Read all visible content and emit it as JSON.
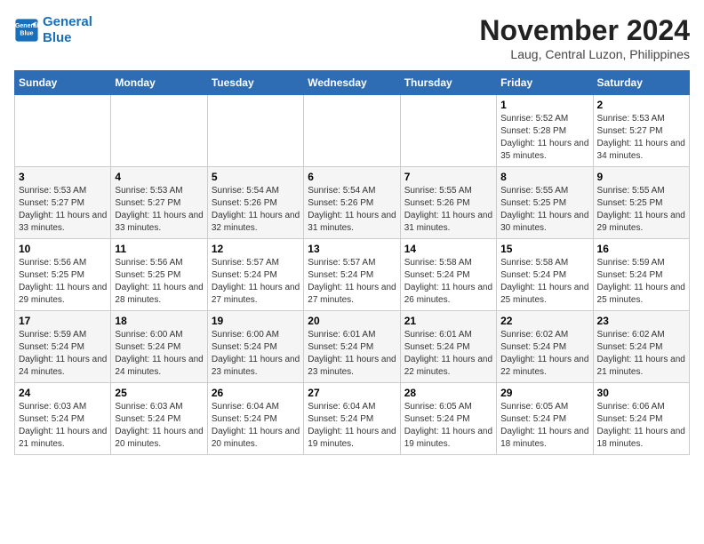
{
  "header": {
    "logo_line1": "General",
    "logo_line2": "Blue",
    "month_title": "November 2024",
    "location": "Laug, Central Luzon, Philippines"
  },
  "weekdays": [
    "Sunday",
    "Monday",
    "Tuesday",
    "Wednesday",
    "Thursday",
    "Friday",
    "Saturday"
  ],
  "weeks": [
    [
      {
        "day": "",
        "info": ""
      },
      {
        "day": "",
        "info": ""
      },
      {
        "day": "",
        "info": ""
      },
      {
        "day": "",
        "info": ""
      },
      {
        "day": "",
        "info": ""
      },
      {
        "day": "1",
        "info": "Sunrise: 5:52 AM\nSunset: 5:28 PM\nDaylight: 11 hours and 35 minutes."
      },
      {
        "day": "2",
        "info": "Sunrise: 5:53 AM\nSunset: 5:27 PM\nDaylight: 11 hours and 34 minutes."
      }
    ],
    [
      {
        "day": "3",
        "info": "Sunrise: 5:53 AM\nSunset: 5:27 PM\nDaylight: 11 hours and 33 minutes."
      },
      {
        "day": "4",
        "info": "Sunrise: 5:53 AM\nSunset: 5:27 PM\nDaylight: 11 hours and 33 minutes."
      },
      {
        "day": "5",
        "info": "Sunrise: 5:54 AM\nSunset: 5:26 PM\nDaylight: 11 hours and 32 minutes."
      },
      {
        "day": "6",
        "info": "Sunrise: 5:54 AM\nSunset: 5:26 PM\nDaylight: 11 hours and 31 minutes."
      },
      {
        "day": "7",
        "info": "Sunrise: 5:55 AM\nSunset: 5:26 PM\nDaylight: 11 hours and 31 minutes."
      },
      {
        "day": "8",
        "info": "Sunrise: 5:55 AM\nSunset: 5:25 PM\nDaylight: 11 hours and 30 minutes."
      },
      {
        "day": "9",
        "info": "Sunrise: 5:55 AM\nSunset: 5:25 PM\nDaylight: 11 hours and 29 minutes."
      }
    ],
    [
      {
        "day": "10",
        "info": "Sunrise: 5:56 AM\nSunset: 5:25 PM\nDaylight: 11 hours and 29 minutes."
      },
      {
        "day": "11",
        "info": "Sunrise: 5:56 AM\nSunset: 5:25 PM\nDaylight: 11 hours and 28 minutes."
      },
      {
        "day": "12",
        "info": "Sunrise: 5:57 AM\nSunset: 5:24 PM\nDaylight: 11 hours and 27 minutes."
      },
      {
        "day": "13",
        "info": "Sunrise: 5:57 AM\nSunset: 5:24 PM\nDaylight: 11 hours and 27 minutes."
      },
      {
        "day": "14",
        "info": "Sunrise: 5:58 AM\nSunset: 5:24 PM\nDaylight: 11 hours and 26 minutes."
      },
      {
        "day": "15",
        "info": "Sunrise: 5:58 AM\nSunset: 5:24 PM\nDaylight: 11 hours and 25 minutes."
      },
      {
        "day": "16",
        "info": "Sunrise: 5:59 AM\nSunset: 5:24 PM\nDaylight: 11 hours and 25 minutes."
      }
    ],
    [
      {
        "day": "17",
        "info": "Sunrise: 5:59 AM\nSunset: 5:24 PM\nDaylight: 11 hours and 24 minutes."
      },
      {
        "day": "18",
        "info": "Sunrise: 6:00 AM\nSunset: 5:24 PM\nDaylight: 11 hours and 24 minutes."
      },
      {
        "day": "19",
        "info": "Sunrise: 6:00 AM\nSunset: 5:24 PM\nDaylight: 11 hours and 23 minutes."
      },
      {
        "day": "20",
        "info": "Sunrise: 6:01 AM\nSunset: 5:24 PM\nDaylight: 11 hours and 23 minutes."
      },
      {
        "day": "21",
        "info": "Sunrise: 6:01 AM\nSunset: 5:24 PM\nDaylight: 11 hours and 22 minutes."
      },
      {
        "day": "22",
        "info": "Sunrise: 6:02 AM\nSunset: 5:24 PM\nDaylight: 11 hours and 22 minutes."
      },
      {
        "day": "23",
        "info": "Sunrise: 6:02 AM\nSunset: 5:24 PM\nDaylight: 11 hours and 21 minutes."
      }
    ],
    [
      {
        "day": "24",
        "info": "Sunrise: 6:03 AM\nSunset: 5:24 PM\nDaylight: 11 hours and 21 minutes."
      },
      {
        "day": "25",
        "info": "Sunrise: 6:03 AM\nSunset: 5:24 PM\nDaylight: 11 hours and 20 minutes."
      },
      {
        "day": "26",
        "info": "Sunrise: 6:04 AM\nSunset: 5:24 PM\nDaylight: 11 hours and 20 minutes."
      },
      {
        "day": "27",
        "info": "Sunrise: 6:04 AM\nSunset: 5:24 PM\nDaylight: 11 hours and 19 minutes."
      },
      {
        "day": "28",
        "info": "Sunrise: 6:05 AM\nSunset: 5:24 PM\nDaylight: 11 hours and 19 minutes."
      },
      {
        "day": "29",
        "info": "Sunrise: 6:05 AM\nSunset: 5:24 PM\nDaylight: 11 hours and 18 minutes."
      },
      {
        "day": "30",
        "info": "Sunrise: 6:06 AM\nSunset: 5:24 PM\nDaylight: 11 hours and 18 minutes."
      }
    ]
  ]
}
